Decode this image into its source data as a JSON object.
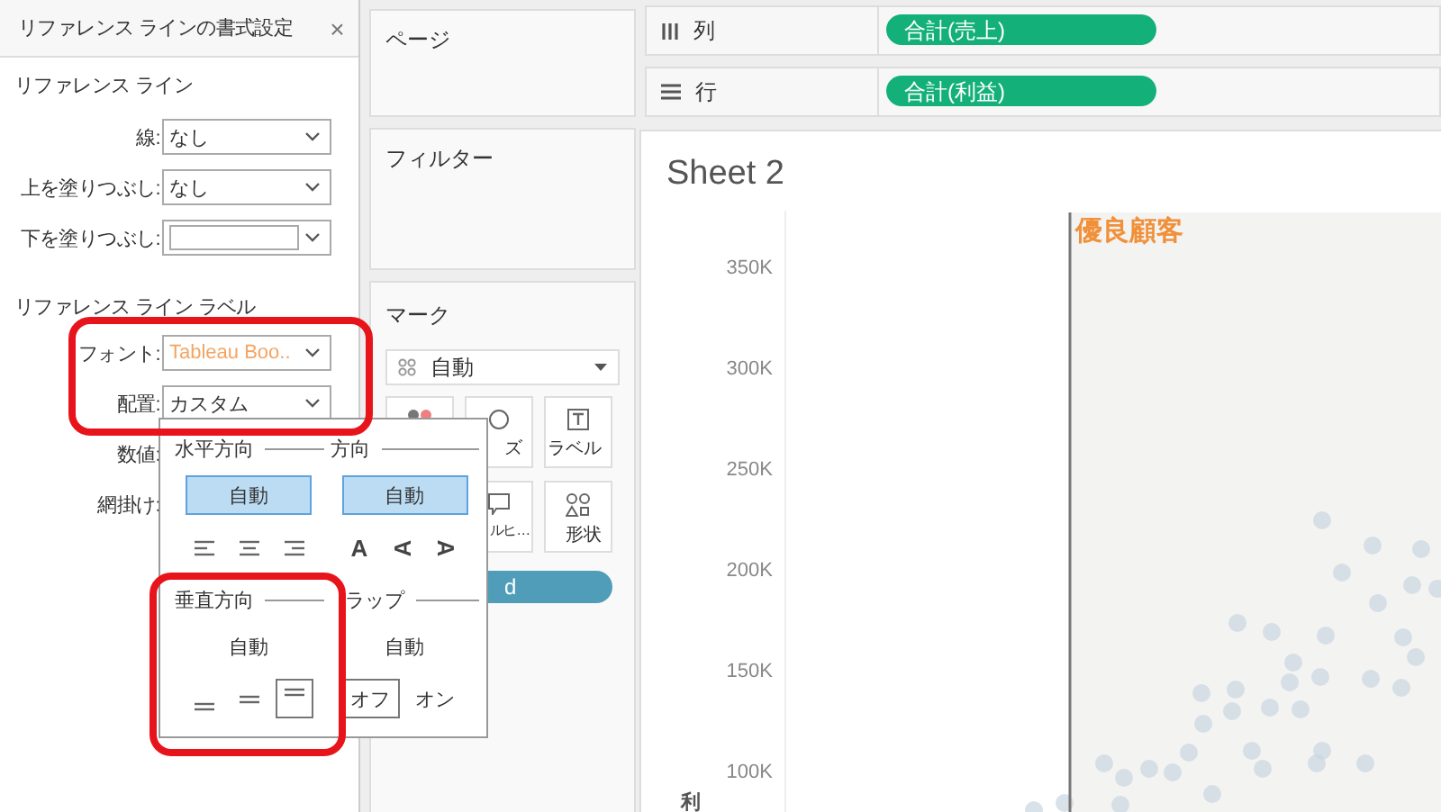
{
  "format_panel": {
    "title": "リファレンス ラインの書式設定",
    "close": "×",
    "line_section": {
      "heading": "リファレンス ライン",
      "fields": [
        {
          "label": "線:",
          "kind": "dropdown",
          "value": "なし"
        },
        {
          "label": "上を塗りつぶし:",
          "kind": "dropdown",
          "value": "なし"
        },
        {
          "label": "下を塗りつぶし:",
          "kind": "swatch"
        }
      ]
    },
    "label_section": {
      "heading": "リファレンス ライン ラベル",
      "fields": [
        {
          "label": "フォント:",
          "kind": "dropdown",
          "value": "Tableau Boo..",
          "color": "#f4a462"
        },
        {
          "label": "配置:",
          "kind": "dropdown",
          "value": "カスタム"
        },
        {
          "label": "数値:",
          "kind": "covered"
        },
        {
          "label": "網掛け:",
          "kind": "covered"
        }
      ]
    }
  },
  "alignment_popup": {
    "sections": [
      {
        "title": "水平方向",
        "auto": {
          "label": "自動",
          "selected": true
        },
        "options": [
          {
            "kind": "align-left",
            "selected": false
          },
          {
            "kind": "align-center",
            "selected": false
          },
          {
            "kind": "align-right",
            "selected": false
          }
        ]
      },
      {
        "title": "方向",
        "auto": {
          "label": "自動",
          "selected": true
        },
        "options": [
          {
            "kind": "upright",
            "glyph": "A",
            "selected": false
          },
          {
            "kind": "rotate-up",
            "glyph": "A",
            "selected": false
          },
          {
            "kind": "rotate-down",
            "glyph": "A",
            "selected": false
          }
        ]
      },
      {
        "title": "垂直方向",
        "auto": {
          "label": "自動",
          "selected": false
        },
        "options": [
          {
            "kind": "valign-bottom",
            "selected": false
          },
          {
            "kind": "valign-middle",
            "selected": false
          },
          {
            "kind": "valign-top",
            "selected": true
          }
        ]
      },
      {
        "title": "ラップ",
        "auto": {
          "label": "自動",
          "selected": false
        },
        "options": [
          {
            "kind": "text",
            "label": "オフ",
            "selected": true
          },
          {
            "kind": "text",
            "label": "オン",
            "selected": false
          }
        ]
      }
    ]
  },
  "highlight_frames": [
    {
      "kind": "frame"
    },
    {
      "kind": "frame"
    }
  ],
  "cards": [
    {
      "title": "ページ"
    },
    {
      "title": "フィルター"
    }
  ],
  "marks": {
    "title": "マーク",
    "mark_type": "自動",
    "buttons": [
      {
        "kind": "color"
      },
      {
        "kind": "size",
        "label": "ズ"
      },
      {
        "kind": "label",
        "label": "ラベル"
      },
      {
        "kind": "tooltip",
        "label": "ルヒ…"
      },
      {
        "kind": "shape",
        "label": "形状"
      }
    ],
    "field_pill": "d"
  },
  "shelves": [
    {
      "kind": "columns",
      "label": "列",
      "pill": "合計(売上)"
    },
    {
      "kind": "rows",
      "label": "行",
      "pill": "合計(利益)"
    }
  ],
  "sheet": {
    "title": "Sheet 2",
    "axis_title": "利",
    "tick_labels": [
      "350K",
      "300K",
      "250K",
      "200K",
      "150K",
      "100K"
    ],
    "reference_line": {
      "label": "優良顧客",
      "color": "#f0913a"
    }
  }
}
